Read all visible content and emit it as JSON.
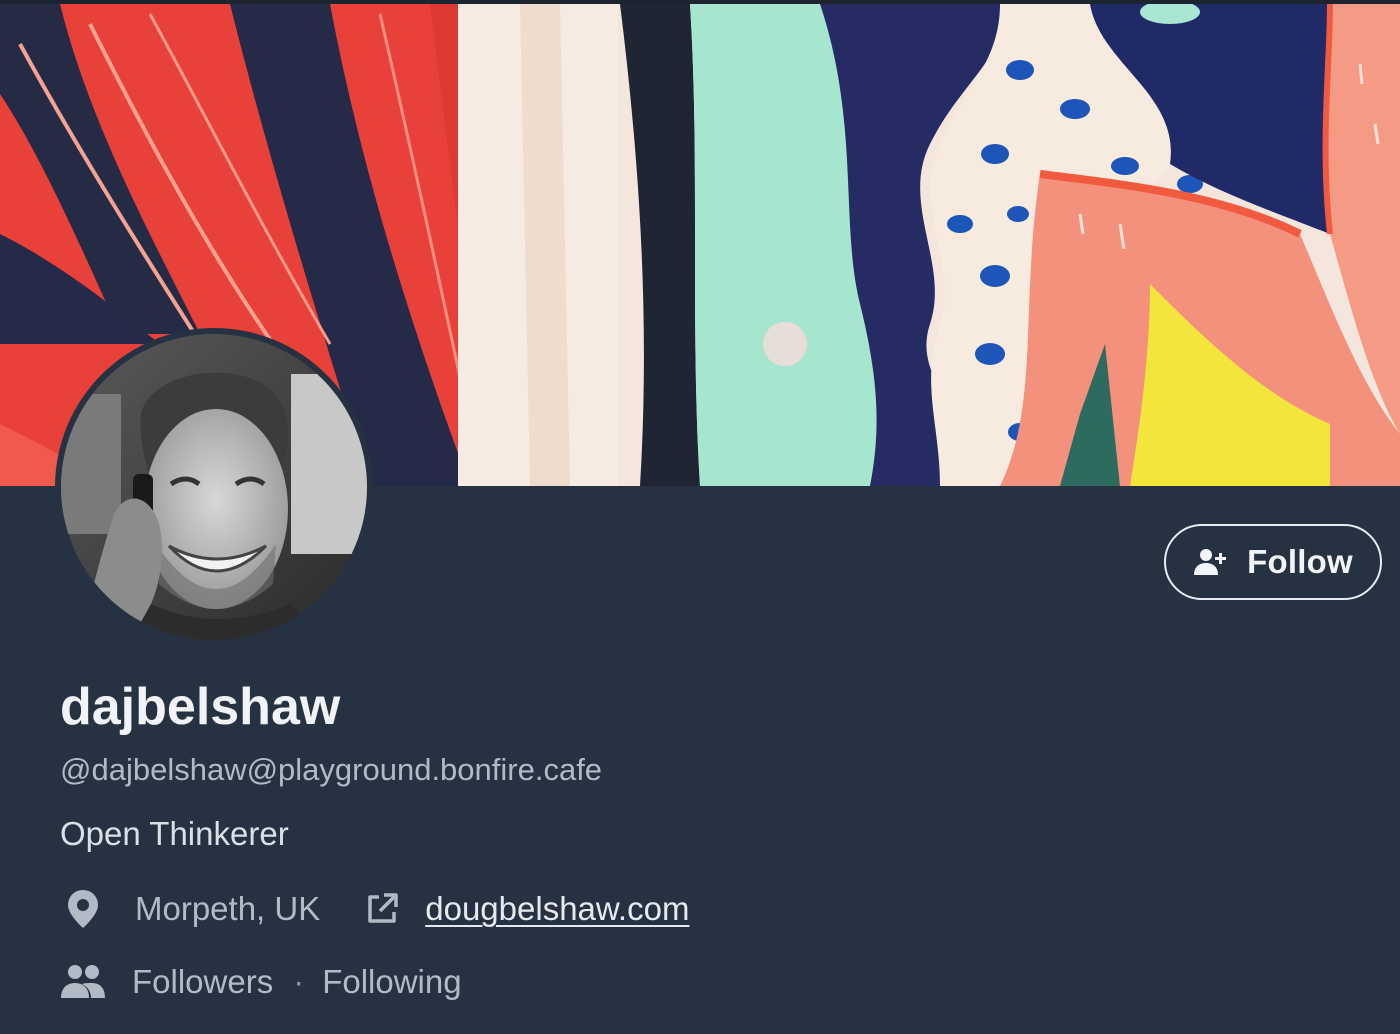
{
  "profile": {
    "display_name": "dajbelshaw",
    "handle": "@dajbelshaw@playground.bonfire.cafe",
    "bio": "Open Thinkerer",
    "location": "Morpeth, UK",
    "website": "dougbelshaw.com",
    "followers_label": "Followers",
    "separator": "·",
    "following_label": "Following"
  },
  "actions": {
    "follow_label": "Follow"
  },
  "icons": {
    "follow": "person-add-icon",
    "location": "map-pin-icon",
    "website": "external-link-icon",
    "social": "people-icon"
  },
  "colors": {
    "background": "#263142",
    "banner_red": "#e8413a",
    "banner_navy": "#24265a",
    "banner_pink": "#f48f7c",
    "banner_mint": "#a3e3cd",
    "banner_yellow": "#f2e23a",
    "banner_cream": "#f6e8de",
    "text_primary": "#f1f3f6",
    "text_secondary": "#b2bac6"
  }
}
